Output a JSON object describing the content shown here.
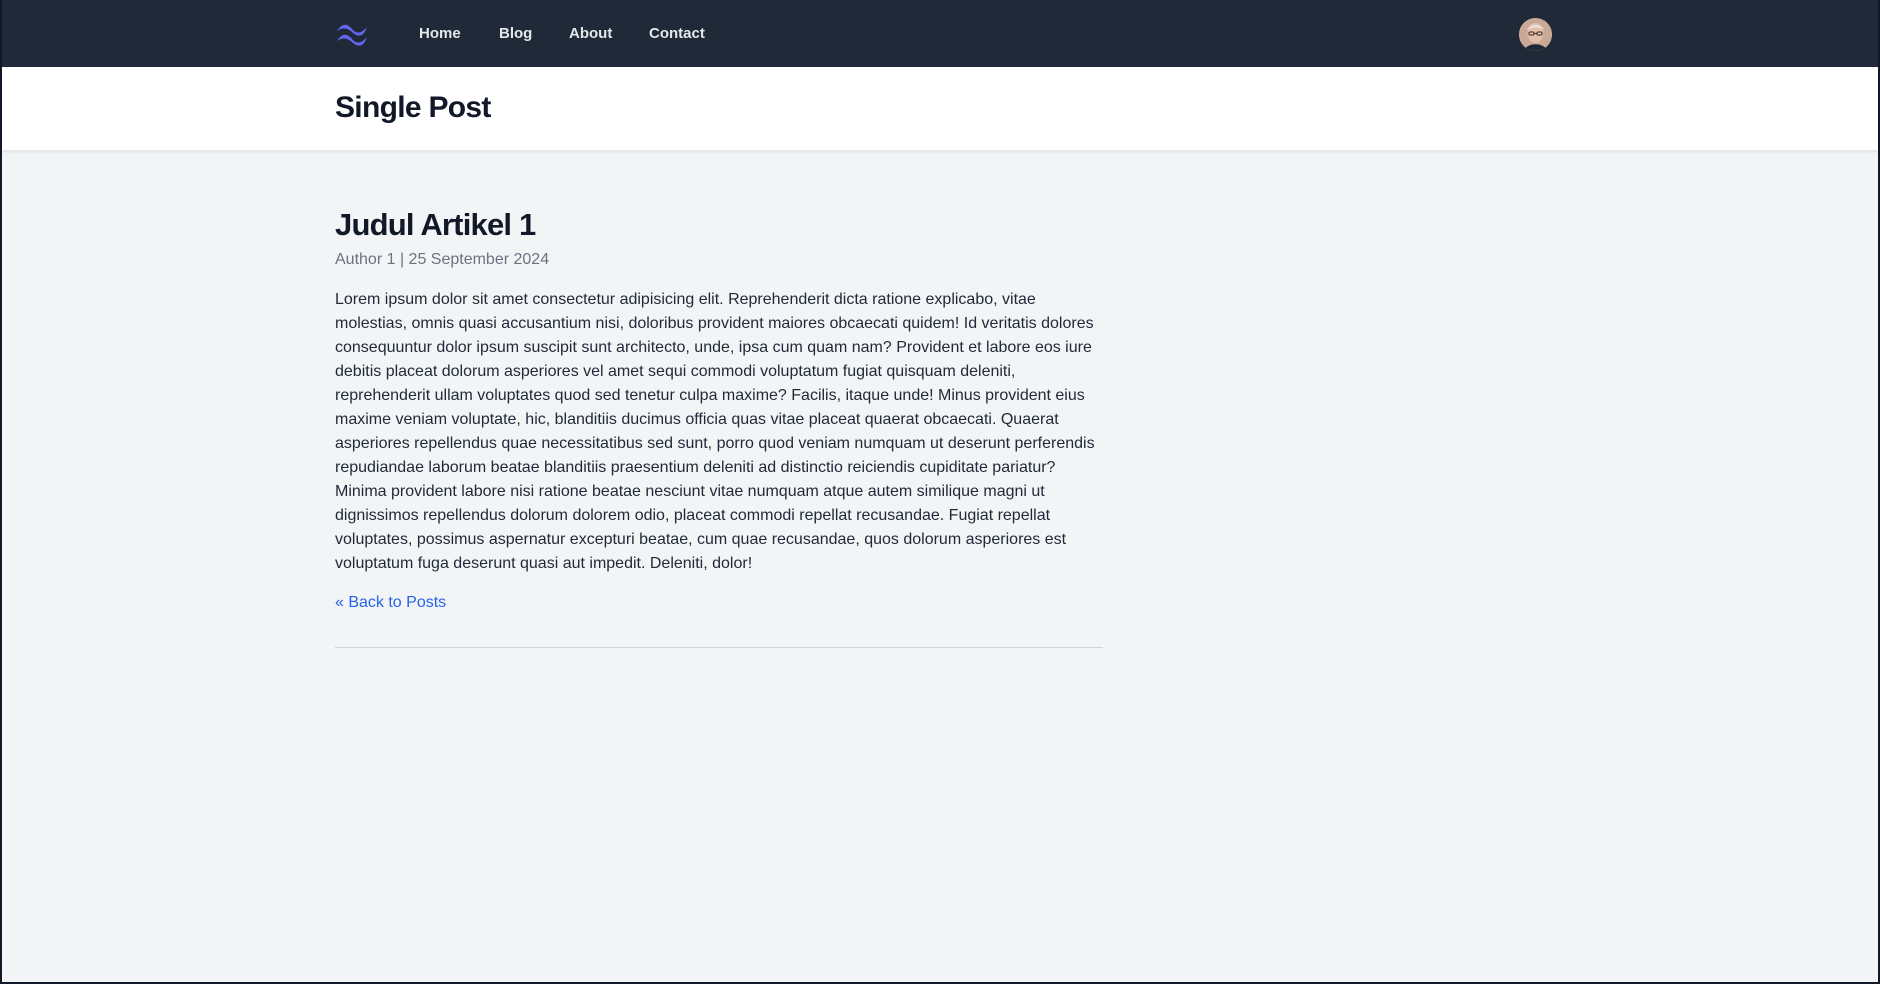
{
  "navbar": {
    "logo_icon": "tailwind-wave-icon",
    "links": [
      {
        "label": "Home"
      },
      {
        "label": "Blog"
      },
      {
        "label": "About"
      },
      {
        "label": "Contact"
      }
    ],
    "avatar_icon": "user-avatar"
  },
  "header": {
    "title": "Single Post"
  },
  "post": {
    "title": "Judul Artikel 1",
    "author": "Author 1",
    "date": "25 September 2024",
    "body": "Lorem ipsum dolor sit amet consectetur adipisicing elit. Reprehenderit dicta ratione explicabo, vitae molestias, omnis quasi accusantium nisi, doloribus provident maiores obcaecati quidem! Id veritatis dolores consequuntur dolor ipsum suscipit sunt architecto, unde, ipsa cum quam nam? Provident et labore eos iure debitis placeat dolorum asperiores vel amet sequi commodi voluptatum fugiat quisquam deleniti, reprehenderit ullam voluptates quod sed tenetur culpa maxime? Facilis, itaque unde! Minus provident eius maxime veniam voluptate, hic, blanditiis ducimus officia quas vitae placeat quaerat obcaecati. Quaerat asperiores repellendus quae necessitatibus sed sunt, porro quod veniam numquam ut deserunt perferendis repudiandae laborum beatae blanditiis praesentium deleniti ad distinctio reiciendis cupiditate pariatur? Minima provident labore nisi ratione beatae nesciunt vitae numquam atque autem similique magni ut dignissimos repellendus dolorum dolorem odio, placeat commodi repellat recusandae. Fugiat repellat voluptates, possimus aspernatur excepturi beatae, cum quae recusandae, quos dolorum asperiores est voluptatum fuga deserunt quasi aut impedit. Deleniti, dolor!",
    "back_label": "« Back to Posts"
  },
  "colors": {
    "navbar": "#1f2937",
    "page_background": "#f3f4f6",
    "link": "#2563eb",
    "logo": "#6366f1"
  }
}
